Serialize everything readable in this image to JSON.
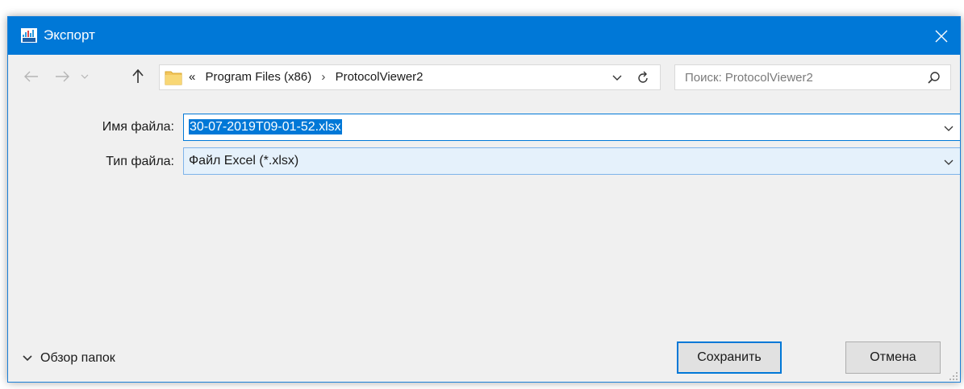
{
  "window": {
    "title": "Экспорт"
  },
  "navigation": {
    "path_prefix": "«",
    "breadcrumbs": [
      "Program Files (x86)",
      "ProtocolViewer2"
    ],
    "breadcrumb_separator": "›"
  },
  "search": {
    "placeholder": "Поиск: ProtocolViewer2"
  },
  "form": {
    "filename_label": "Имя файла:",
    "filename_value": "30-07-2019T09-01-52.xlsx",
    "filetype_label": "Тип файла:",
    "filetype_value": "Файл Excel (*.xlsx)"
  },
  "footer": {
    "browse_label": "Обзор папок",
    "save_label": "Сохранить",
    "cancel_label": "Отмена"
  },
  "colors": {
    "accent": "#0078d7",
    "dialog_bg": "#f0f0f0"
  }
}
